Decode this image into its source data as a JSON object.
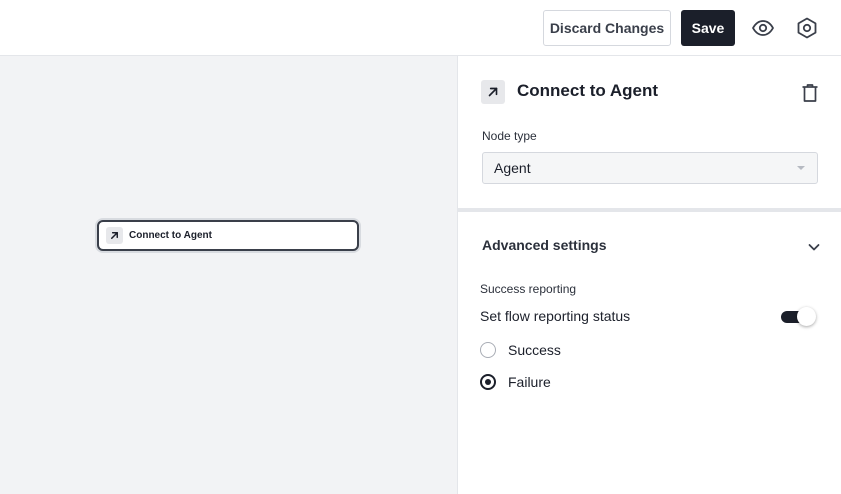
{
  "toolbar": {
    "discard_label": "Discard Changes",
    "save_label": "Save",
    "preview_icon": "eye-icon",
    "settings_icon": "hexagon-settings-icon"
  },
  "canvas": {
    "node": {
      "label": "Connect to Agent",
      "icon": "arrow-up-right-icon"
    }
  },
  "panel": {
    "title": "Connect to Agent",
    "title_icon": "arrow-up-right-icon",
    "delete_icon": "trash-icon",
    "node_type": {
      "label": "Node type",
      "value": "Agent"
    },
    "advanced": {
      "title": "Advanced settings",
      "expanded": true,
      "success_reporting": {
        "label": "Success reporting",
        "toggle_label": "Set flow reporting status",
        "toggle_on": true,
        "options": [
          "Success",
          "Failure"
        ],
        "selected": "Failure"
      }
    }
  },
  "colors": {
    "primary": "#1b1f2a",
    "canvas_bg": "#f2f3f5",
    "border": "#d5d8de"
  }
}
